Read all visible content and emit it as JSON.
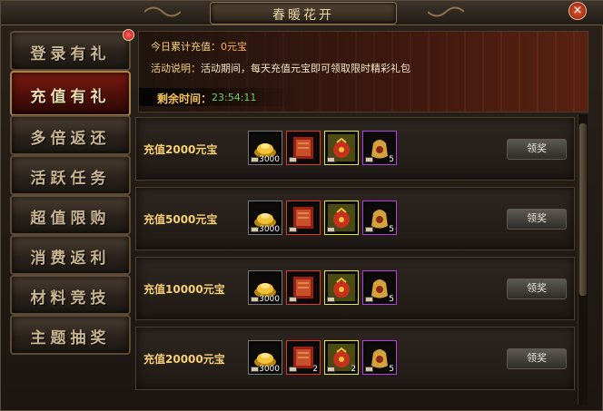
{
  "window": {
    "title": "春暖花开",
    "close_label": "×"
  },
  "nav": {
    "items": [
      {
        "label": "登录有礼",
        "active": false,
        "badge": true
      },
      {
        "label": "充值有礼",
        "active": true,
        "badge": false
      },
      {
        "label": "多倍返还",
        "active": false,
        "badge": false
      },
      {
        "label": "活跃任务",
        "active": false,
        "badge": false
      },
      {
        "label": "超值限购",
        "active": false,
        "badge": false
      },
      {
        "label": "消费返利",
        "active": false,
        "badge": false
      },
      {
        "label": "材料竞技",
        "active": false,
        "badge": false
      },
      {
        "label": "主题抽奖",
        "active": false,
        "badge": false
      }
    ]
  },
  "banner": {
    "total_key": "今日累计充值：",
    "total_value": "0元宝",
    "desc_key": "活动说明：",
    "desc_value": "活动期间，每天充值元宝即可领取限时精彩礼包",
    "time_key": "剩余时间：",
    "time_value": "23:54:11"
  },
  "rewards": [
    {
      "label": "充值2000元宝",
      "button": "领奖",
      "items": [
        {
          "icon": "gold-ingot-icon",
          "frame": "gray",
          "count": "3000"
        },
        {
          "icon": "red-scroll-icon",
          "frame": "red",
          "count": ""
        },
        {
          "icon": "red-pouch-icon",
          "frame": "yellow",
          "count": ""
        },
        {
          "icon": "treasure-bag-icon",
          "frame": "purple",
          "count": "5"
        }
      ]
    },
    {
      "label": "充值5000元宝",
      "button": "领奖",
      "items": [
        {
          "icon": "gold-ingot-icon",
          "frame": "gray",
          "count": "3000"
        },
        {
          "icon": "red-scroll-icon",
          "frame": "red",
          "count": ""
        },
        {
          "icon": "red-pouch-icon",
          "frame": "yellow",
          "count": ""
        },
        {
          "icon": "treasure-bag-icon",
          "frame": "purple",
          "count": "5"
        }
      ]
    },
    {
      "label": "充值10000元宝",
      "button": "领奖",
      "items": [
        {
          "icon": "gold-ingot-icon",
          "frame": "gray",
          "count": "3000"
        },
        {
          "icon": "red-scroll-icon",
          "frame": "red",
          "count": ""
        },
        {
          "icon": "red-pouch-icon",
          "frame": "yellow",
          "count": ""
        },
        {
          "icon": "treasure-bag-icon",
          "frame": "purple",
          "count": "5"
        }
      ]
    },
    {
      "label": "充值20000元宝",
      "button": "领奖",
      "items": [
        {
          "icon": "gold-ingot-icon",
          "frame": "gray",
          "count": "3000"
        },
        {
          "icon": "red-scroll-icon",
          "frame": "red",
          "count": "2"
        },
        {
          "icon": "red-pouch-icon",
          "frame": "yellow",
          "count": "2"
        },
        {
          "icon": "treasure-bag-icon",
          "frame": "purple",
          "count": "5"
        }
      ]
    }
  ]
}
